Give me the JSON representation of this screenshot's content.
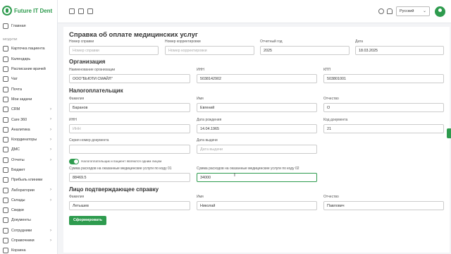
{
  "app": {
    "title": "Future IT Dent"
  },
  "sidebar": {
    "home": "Главная",
    "section_label": "МОДУЛИ",
    "items": [
      {
        "label": "Карточка пациента",
        "chev": false
      },
      {
        "label": "Календарь",
        "chev": false
      },
      {
        "label": "Расписание врачей",
        "chev": false
      },
      {
        "label": "Чат",
        "chev": false
      },
      {
        "label": "Почта",
        "chev": false
      },
      {
        "label": "Мои задачи",
        "chev": false
      },
      {
        "label": "CRM",
        "chev": true
      },
      {
        "label": "Care 360",
        "chev": true
      },
      {
        "label": "Аналитика",
        "chev": true
      },
      {
        "label": "Координаторы",
        "chev": true
      },
      {
        "label": "ДМС",
        "chev": true
      },
      {
        "label": "Отчеты",
        "chev": true
      },
      {
        "label": "Бюджет",
        "chev": false
      },
      {
        "label": "Прибыль клиники",
        "chev": false
      },
      {
        "label": "Лаборатории",
        "chev": true
      },
      {
        "label": "Склады",
        "chev": true
      },
      {
        "label": "Скидки",
        "chev": false
      },
      {
        "label": "Документы",
        "chev": false
      },
      {
        "label": "Сотрудники",
        "chev": true
      },
      {
        "label": "Справочники",
        "chev": true
      },
      {
        "label": "Корзина",
        "chev": false
      }
    ]
  },
  "topbar": {
    "language": "Русский"
  },
  "form": {
    "title": "Справка об оплате медицинских услуг",
    "cert_number": {
      "label": "Номер справки",
      "placeholder": "Номер справки"
    },
    "correction_number": {
      "label": "Номер корректировки",
      "placeholder": "Номер корректировки"
    },
    "report_year": {
      "label": "Отчетный год",
      "value": "2025"
    },
    "date": {
      "label": "Дата",
      "value": "18.03.2025"
    },
    "org_section": "Организация",
    "org_name": {
      "label": "Наименование организации",
      "value": "ООО\"БЬЮТИ СМАЙЛ\""
    },
    "org_inn": {
      "label": "ИНН",
      "value": "5038142902"
    },
    "org_kpp": {
      "label": "КПП",
      "value": "503801001"
    },
    "taxpayer_section": "Налогоплательщик",
    "last_name": {
      "label": "Фамилия",
      "value": "Баранов"
    },
    "first_name": {
      "label": "Имя",
      "value": "Евгений"
    },
    "patronymic": {
      "label": "Отчество",
      "value": "О"
    },
    "inn": {
      "label": "ИНН",
      "placeholder": "ИНН"
    },
    "birth_date": {
      "label": "Дата рождения",
      "value": "14.04.1965"
    },
    "doc_code": {
      "label": "Код документа",
      "value": "21"
    },
    "doc_series": {
      "label": "Серия номер документа",
      "placeholder": ""
    },
    "issue_date": {
      "label": "Дата выдачи",
      "placeholder": "Дата выдачи"
    },
    "toggle_label": "Налогоплательщик и пациент являются одним лицом",
    "sum01": {
      "label": "Сумма расходов на оказанные медицинские услуги по коду 01",
      "value": "88469.5"
    },
    "sum02": {
      "label": "Сумма расходов на оказанные медицинские услуги по коду 02",
      "value": "34000"
    },
    "confirm_section": "Лицо подтверждающее справку",
    "c_last_name": {
      "label": "Фамилия",
      "value": "Летышев"
    },
    "c_first_name": {
      "label": "Имя",
      "value": "Николай"
    },
    "c_patronymic": {
      "label": "Отчество",
      "value": "Павлович"
    },
    "submit": "Сформировать"
  },
  "colors": {
    "accent": "#2e9b4e"
  }
}
